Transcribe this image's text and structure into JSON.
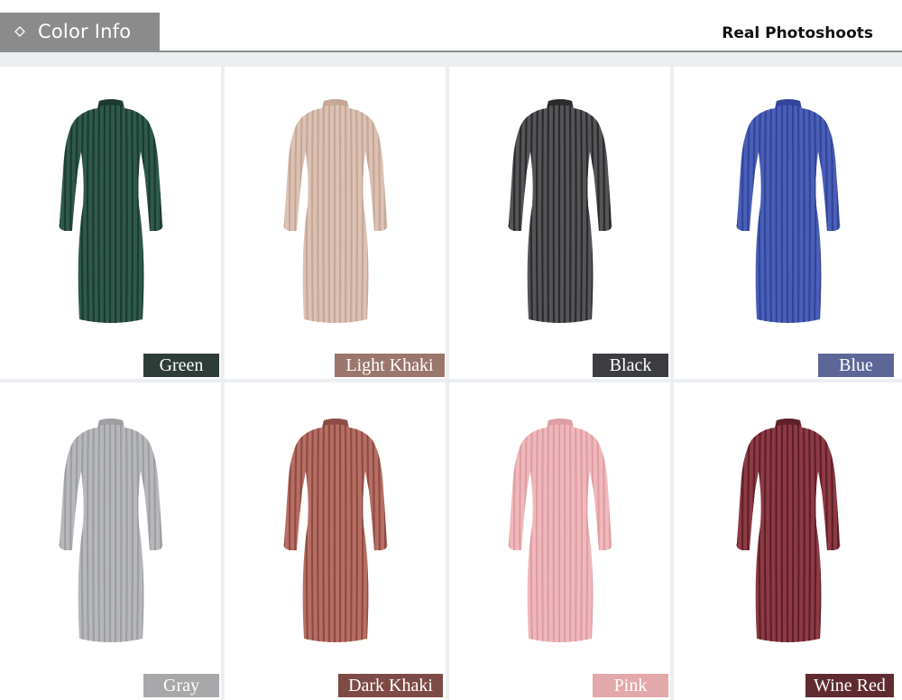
{
  "header": {
    "tab_title": "Color Info",
    "tab_icon": "diamond-icon",
    "subtitle": "Real Photoshoots"
  },
  "colors": [
    {
      "name": "Green",
      "dress_color": "#2f5a4a",
      "rib_color": "#1d3a30",
      "label_bg": "#2e3d38"
    },
    {
      "name": "Light Khaki",
      "dress_color": "#dcc1b4",
      "rib_color": "#c5a797",
      "label_bg": "#9a766c"
    },
    {
      "name": "Black",
      "dress_color": "#555558",
      "rib_color": "#2b2b2e",
      "label_bg": "#3c3d40"
    },
    {
      "name": "Blue",
      "dress_color": "#4a5fb8",
      "rib_color": "#33449a",
      "label_bg": "#5c6797"
    },
    {
      "name": "Gray",
      "dress_color": "#b7b8bb",
      "rib_color": "#9d9ea2",
      "label_bg": "#a8a8aa"
    },
    {
      "name": "Dark Khaki",
      "dress_color": "#b86e63",
      "rib_color": "#8c4c46",
      "label_bg": "#7e4a45"
    },
    {
      "name": "Pink",
      "dress_color": "#f0b8bc",
      "rib_color": "#dd9ea3",
      "label_bg": "#e2a8aa"
    },
    {
      "name": "Wine Red",
      "dress_color": "#8e3a45",
      "rib_color": "#5e2028",
      "label_bg": "#5f2b31"
    }
  ]
}
